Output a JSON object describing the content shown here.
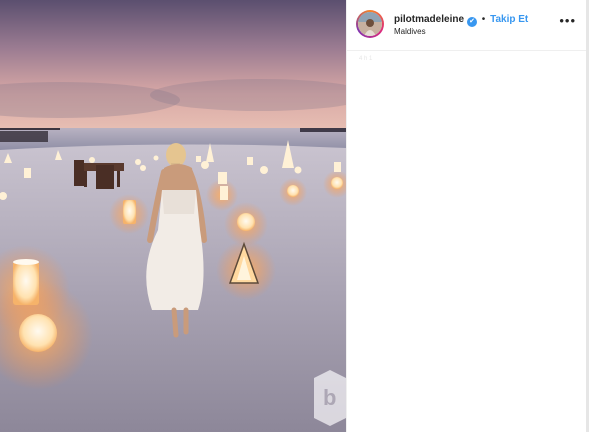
{
  "post": {
    "username": "pilotmadeleine",
    "follow_label": "Takip Et",
    "separator": "•",
    "location": "Maldives",
    "verified_icon": "✔",
    "more_label": "•••",
    "faint_label": "4 h 1"
  },
  "photo": {
    "description_icon": "beach-lanterns-photo",
    "watermark_letter": "b"
  },
  "colors": {
    "accent": "#3897f0",
    "text": "#262626",
    "border": "#efefef"
  }
}
